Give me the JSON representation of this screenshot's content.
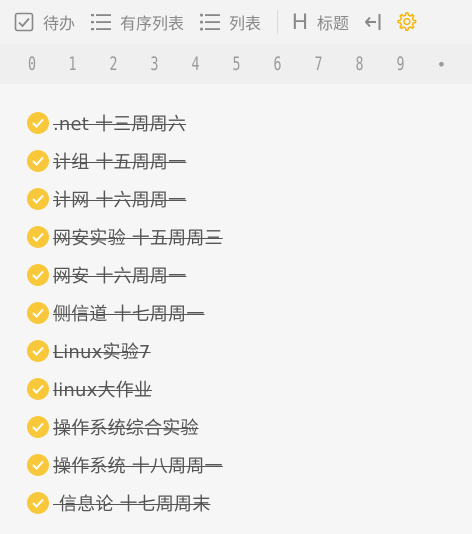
{
  "toolbar": {
    "todo_label": "待办",
    "ordered_list_label": "有序列表",
    "list_label": "列表",
    "heading_label": "标题",
    "heading_glyph": "H"
  },
  "digits": [
    "0",
    "1",
    "2",
    "3",
    "4",
    "5",
    "6",
    "7",
    "8",
    "9",
    "•"
  ],
  "todos": [
    {
      "text": ".net 十三周周六",
      "done": true
    },
    {
      "text": "计组 十五周周一",
      "done": true
    },
    {
      "text": "计网 十六周周一",
      "done": true
    },
    {
      "text": "网安实验 十五周周三",
      "done": true
    },
    {
      "text": "网安 十六周周一",
      "done": true
    },
    {
      "text": "侧信道 十七周周一",
      "done": true
    },
    {
      "text": "Linux实验7",
      "done": true
    },
    {
      "text": "linux大作业",
      "done": true
    },
    {
      "text": "操作系统综合实验",
      "done": true
    },
    {
      "text": "操作系统 十八周周一",
      "done": true
    },
    {
      "text": " 信息论 十七周周末",
      "done": true
    }
  ],
  "colors": {
    "check": "#f9c83a",
    "settings_icon": "#f5b400",
    "toolbar_text": "#888888"
  }
}
